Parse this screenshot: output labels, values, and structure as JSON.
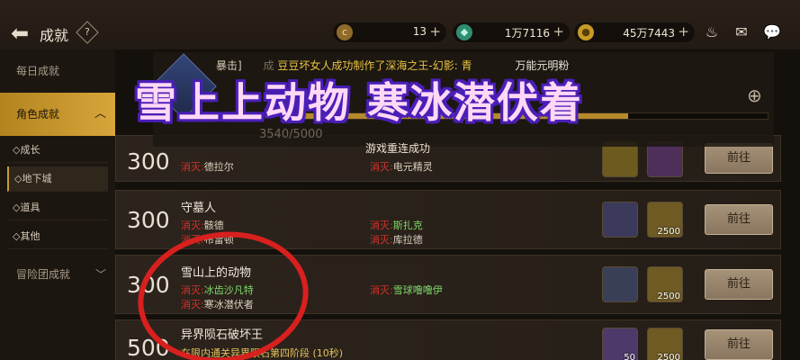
{
  "header": {
    "title": "成就",
    "help": "?"
  },
  "currencies": [
    {
      "icon": "c",
      "value": "13",
      "color": "#8f6b2a"
    },
    {
      "icon": "◆",
      "value": "1万7116",
      "color": "#2f8e72"
    },
    {
      "icon": "●",
      "value": "45万7443",
      "color": "#c69a25"
    }
  ],
  "sidebar": {
    "daily": "每日成就",
    "role": "角色成就",
    "subs": [
      "◇成长",
      "◇地下城",
      "◇道具",
      "◇其他"
    ],
    "adventure": "冒险团成就"
  },
  "progress": {
    "text": "3540/5000",
    "fraction": 0.708
  },
  "ticker": {
    "prefix": "暴击]",
    "cheng": "成",
    "msg": "豆豆坏女人成功制作了",
    "item": "深海之王-幻影: 青",
    "suffix": "万能元明粉"
  },
  "banner": "雪上上动物 寒冰潜伏着",
  "toast": "游戏重连成功",
  "cards": [
    {
      "score": "300",
      "title": "",
      "reqs": [
        {
          "lbl": "消灭:",
          "tgt": "德拉尔"
        },
        {
          "lbl": "消灭:",
          "tgt": "电元精灵"
        }
      ],
      "rewards": [
        {
          "color": "#6d5a1e",
          "count": ""
        },
        {
          "color": "#4d2f5a",
          "count": ""
        }
      ],
      "goto": "前往"
    },
    {
      "score": "300",
      "title": "守墓人",
      "reqs": [
        {
          "lbl": "消灭:",
          "tgt": "骸德"
        },
        {
          "lbl": "消灭:",
          "tgt": "斯扎克"
        },
        {
          "lbl": "消灭:",
          "tgt": "布雷顿"
        },
        {
          "lbl": "消灭:",
          "tgt": "库拉德"
        }
      ],
      "rewards": [
        {
          "color": "#3c3a5a",
          "count": ""
        },
        {
          "color": "#6e5a22",
          "count": "2500"
        }
      ],
      "goto": "前往"
    },
    {
      "score": "300",
      "title": "雪山上的动物",
      "reqs": [
        {
          "lbl": "消灭:",
          "tgt": "冰齿沙凡特"
        },
        {
          "lbl": "消灭:",
          "tgt": "雪球噜噜伊"
        },
        {
          "lbl": "消灭:",
          "tgt": "寒冰潜伏者"
        }
      ],
      "rewards": [
        {
          "color": "#3a3f58",
          "count": ""
        },
        {
          "color": "#6e5a22",
          "count": "2500"
        }
      ],
      "goto": "前往"
    },
    {
      "score": "500",
      "title": "异界陨石破坏王",
      "reqs": [
        {
          "lbl": "",
          "tgt": "在限内通关异界陨石第四阶段 (10秒)"
        }
      ],
      "rewards": [
        {
          "color": "#4c3a6a",
          "count": "50"
        },
        {
          "color": "#6e5a22",
          "count": "2500"
        }
      ],
      "goto": "前往"
    }
  ]
}
